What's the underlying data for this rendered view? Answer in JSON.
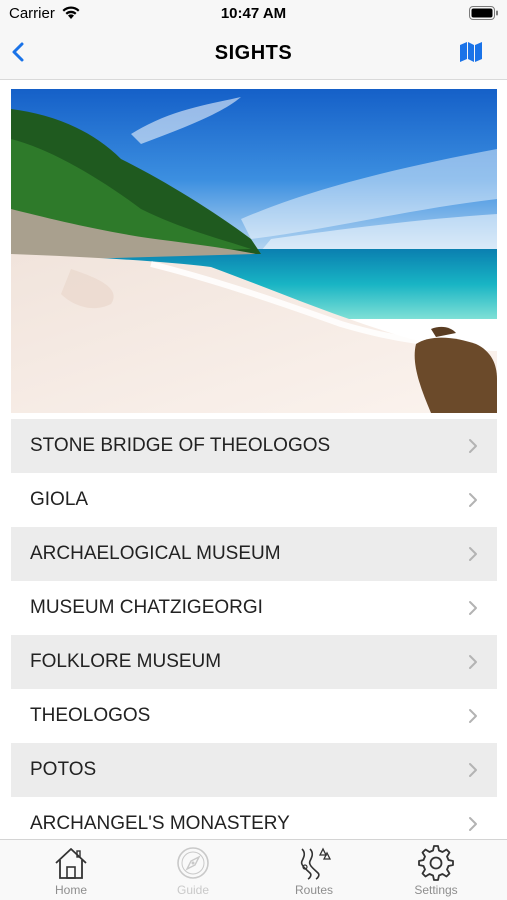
{
  "status_bar": {
    "carrier": "Carrier",
    "time": "10:47 AM",
    "wifi_icon": "wifi-icon",
    "battery_icon": "battery-icon"
  },
  "nav": {
    "title": "SIGHTS",
    "back_icon": "chevron-left-icon",
    "map_icon": "map-icon",
    "accent_color": "#1a73e8"
  },
  "hero": {
    "description_icon": "beach-photo"
  },
  "sights": [
    {
      "label": "STONE BRIDGE OF THEOLOGOS",
      "shaded": true
    },
    {
      "label": "GIOLA",
      "shaded": false
    },
    {
      "label": "ARCHAELOGICAL MUSEUM",
      "shaded": true
    },
    {
      "label": "MUSEUM CHATZIGEORGI",
      "shaded": false
    },
    {
      "label": "FOLKLORE MUSEUM",
      "shaded": true
    },
    {
      "label": "THEOLOGOS",
      "shaded": false
    },
    {
      "label": "POTOS",
      "shaded": true
    },
    {
      "label": "ARCHANGEL'S MONASTERY",
      "shaded": false
    }
  ],
  "tabs": [
    {
      "label": "Home",
      "icon": "home-icon",
      "enabled": true
    },
    {
      "label": "Guide",
      "icon": "compass-icon",
      "enabled": false
    },
    {
      "label": "Routes",
      "icon": "routes-icon",
      "enabled": true
    },
    {
      "label": "Settings",
      "icon": "gear-icon",
      "enabled": true
    }
  ]
}
